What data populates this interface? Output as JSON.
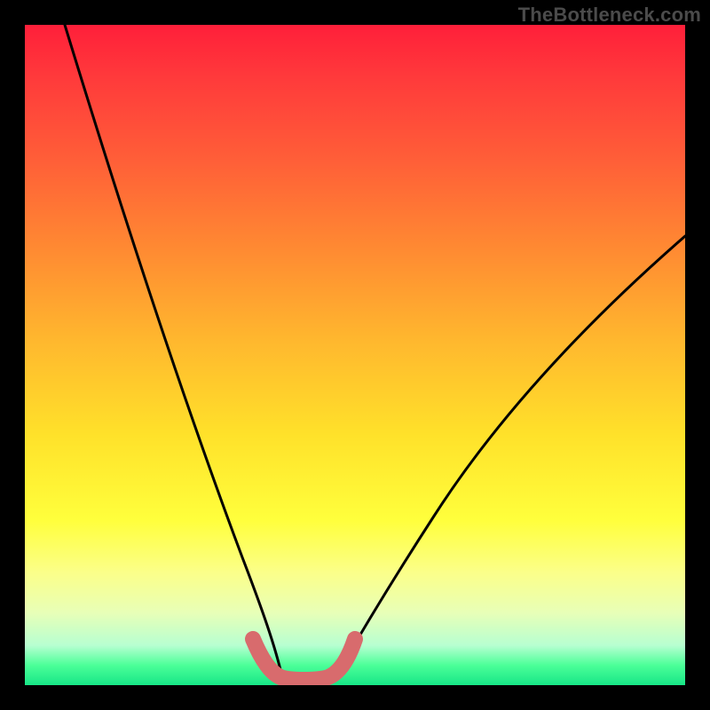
{
  "watermark": {
    "text": "TheBottleneck.com"
  },
  "chart_data": {
    "type": "line",
    "title": "",
    "xlabel": "",
    "ylabel": "",
    "xlim": [
      0,
      100
    ],
    "ylim": [
      0,
      100
    ],
    "series": [
      {
        "name": "left-curve",
        "x": [
          6,
          10,
          14,
          18,
          22,
          26,
          30,
          33,
          35.5,
          37.5,
          38.5
        ],
        "y": [
          100,
          82,
          66,
          51,
          38,
          26,
          16,
          8,
          4,
          1.5,
          0.5
        ]
      },
      {
        "name": "right-curve",
        "x": [
          47,
          49,
          52,
          56,
          62,
          70,
          80,
          90,
          100
        ],
        "y": [
          0.5,
          2,
          5,
          10,
          18,
          29,
          43,
          56,
          68
        ]
      },
      {
        "name": "bottom-highlight",
        "x": [
          34.5,
          36.5,
          38,
          40,
          43,
          46,
          48,
          49.5
        ],
        "y": [
          6.5,
          3,
          1.5,
          1,
          1,
          1.5,
          3,
          6.5
        ]
      }
    ],
    "gradient_stops": [
      {
        "pos": 0,
        "color": "#ff1f3a"
      },
      {
        "pos": 20,
        "color": "#ff5d38"
      },
      {
        "pos": 48,
        "color": "#ffb82e"
      },
      {
        "pos": 75,
        "color": "#ffff3c"
      },
      {
        "pos": 94,
        "color": "#b7ffd1"
      },
      {
        "pos": 100,
        "color": "#17e687"
      }
    ]
  }
}
